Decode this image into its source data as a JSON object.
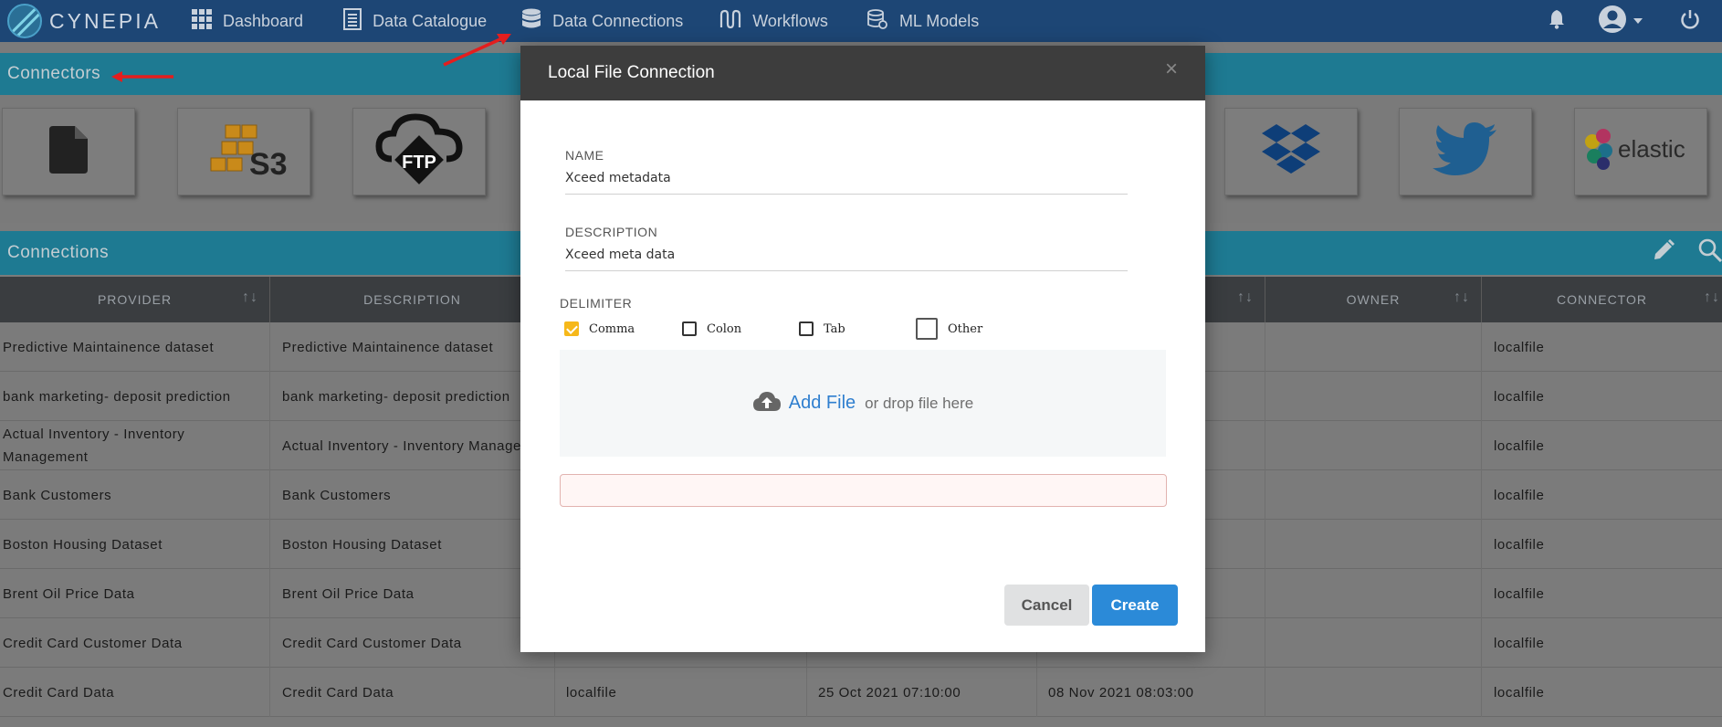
{
  "app": {
    "brand": "CYNEPIA"
  },
  "nav": {
    "items": [
      {
        "label": "Dashboard",
        "icon": "grid-icon"
      },
      {
        "label": "Data Catalogue",
        "icon": "document-icon"
      },
      {
        "label": "Data Connections",
        "icon": "database-icon"
      },
      {
        "label": "Workflows",
        "icon": "workflow-icon"
      },
      {
        "label": "ML Models",
        "icon": "ml-models-icon"
      }
    ],
    "right_icons": [
      "bell-icon",
      "user-icon",
      "caret-down-icon",
      "power-icon"
    ]
  },
  "connectors": {
    "title": "Connectors",
    "tiles": [
      {
        "name": "local-file",
        "icon": "file-icon"
      },
      {
        "name": "s3",
        "icon": "aws-s3-icon",
        "text": "S3"
      },
      {
        "name": "ftp",
        "icon": "ftp-icon",
        "text": "FTP"
      },
      {
        "name": "dropbox",
        "icon": "dropbox-icon"
      },
      {
        "name": "twitter",
        "icon": "twitter-icon"
      },
      {
        "name": "elastic",
        "icon": "elastic-icon",
        "text": "elastic"
      }
    ]
  },
  "connections": {
    "title": "Connections",
    "tools": [
      "edit-icon",
      "search-icon"
    ],
    "columns": [
      "PROVIDER",
      "DESCRIPTION",
      "OWNER",
      "CONNECTOR"
    ],
    "sort_glyph": "↑↓",
    "rows": [
      {
        "provider": "Predictive Maintainence dataset",
        "description": "Predictive Maintainence dataset",
        "type": "",
        "created": "",
        "modified": "",
        "owner": "",
        "connector": "localfile"
      },
      {
        "provider": "bank marketing- deposit prediction",
        "description": "bank marketing- deposit prediction",
        "type": "",
        "created": "",
        "modified": "",
        "owner": "",
        "connector": "localfile"
      },
      {
        "provider": "Actual Inventory - Inventory Management",
        "description": "Actual Inventory - Inventory Management",
        "type": "",
        "created": "",
        "modified": "",
        "owner": "",
        "connector": "localfile"
      },
      {
        "provider": "Bank Customers",
        "description": "Bank Customers",
        "type": "",
        "created": "",
        "modified": "",
        "owner": "",
        "connector": "localfile"
      },
      {
        "provider": "Boston Housing Dataset",
        "description": "Boston Housing Dataset",
        "type": "",
        "created": "",
        "modified": "",
        "owner": "",
        "connector": "localfile"
      },
      {
        "provider": "Brent Oil Price Data",
        "description": "Brent Oil Price Data",
        "type": "",
        "created": "",
        "modified": "",
        "owner": "",
        "connector": "localfile"
      },
      {
        "provider": "Credit Card Customer Data",
        "description": "Credit Card Customer Data",
        "type": "",
        "created": "",
        "modified": "",
        "owner": "",
        "connector": "localfile"
      },
      {
        "provider": "Credit Card Data",
        "description": "Credit Card Data",
        "type": "localfile",
        "created": "25 Oct 2021 07:10:00",
        "modified": "08 Nov 2021 08:03:00",
        "owner": "",
        "connector": "localfile"
      }
    ]
  },
  "modal": {
    "title": "Local File Connection",
    "close": "×",
    "name_label": "NAME",
    "name_value": "Xceed metadata",
    "description_label": "DESCRIPTION",
    "description_value": "Xceed meta data",
    "delimiter_label": "DELIMITER",
    "delimiters": [
      {
        "label": "Comma",
        "checked": true
      },
      {
        "label": "Colon",
        "checked": false
      },
      {
        "label": "Tab",
        "checked": false
      },
      {
        "label": "Other",
        "checked": false
      }
    ],
    "add_file": "Add File",
    "drop_text": "or drop file here",
    "cancel": "Cancel",
    "create": "Create"
  },
  "colors": {
    "nav_bg": "#1d4675",
    "bar_bg": "#1e7a92",
    "accent_blue": "#2b8ad8",
    "checkbox_checked": "#f6b81a",
    "annotation_arrow": "#e41e1e"
  }
}
